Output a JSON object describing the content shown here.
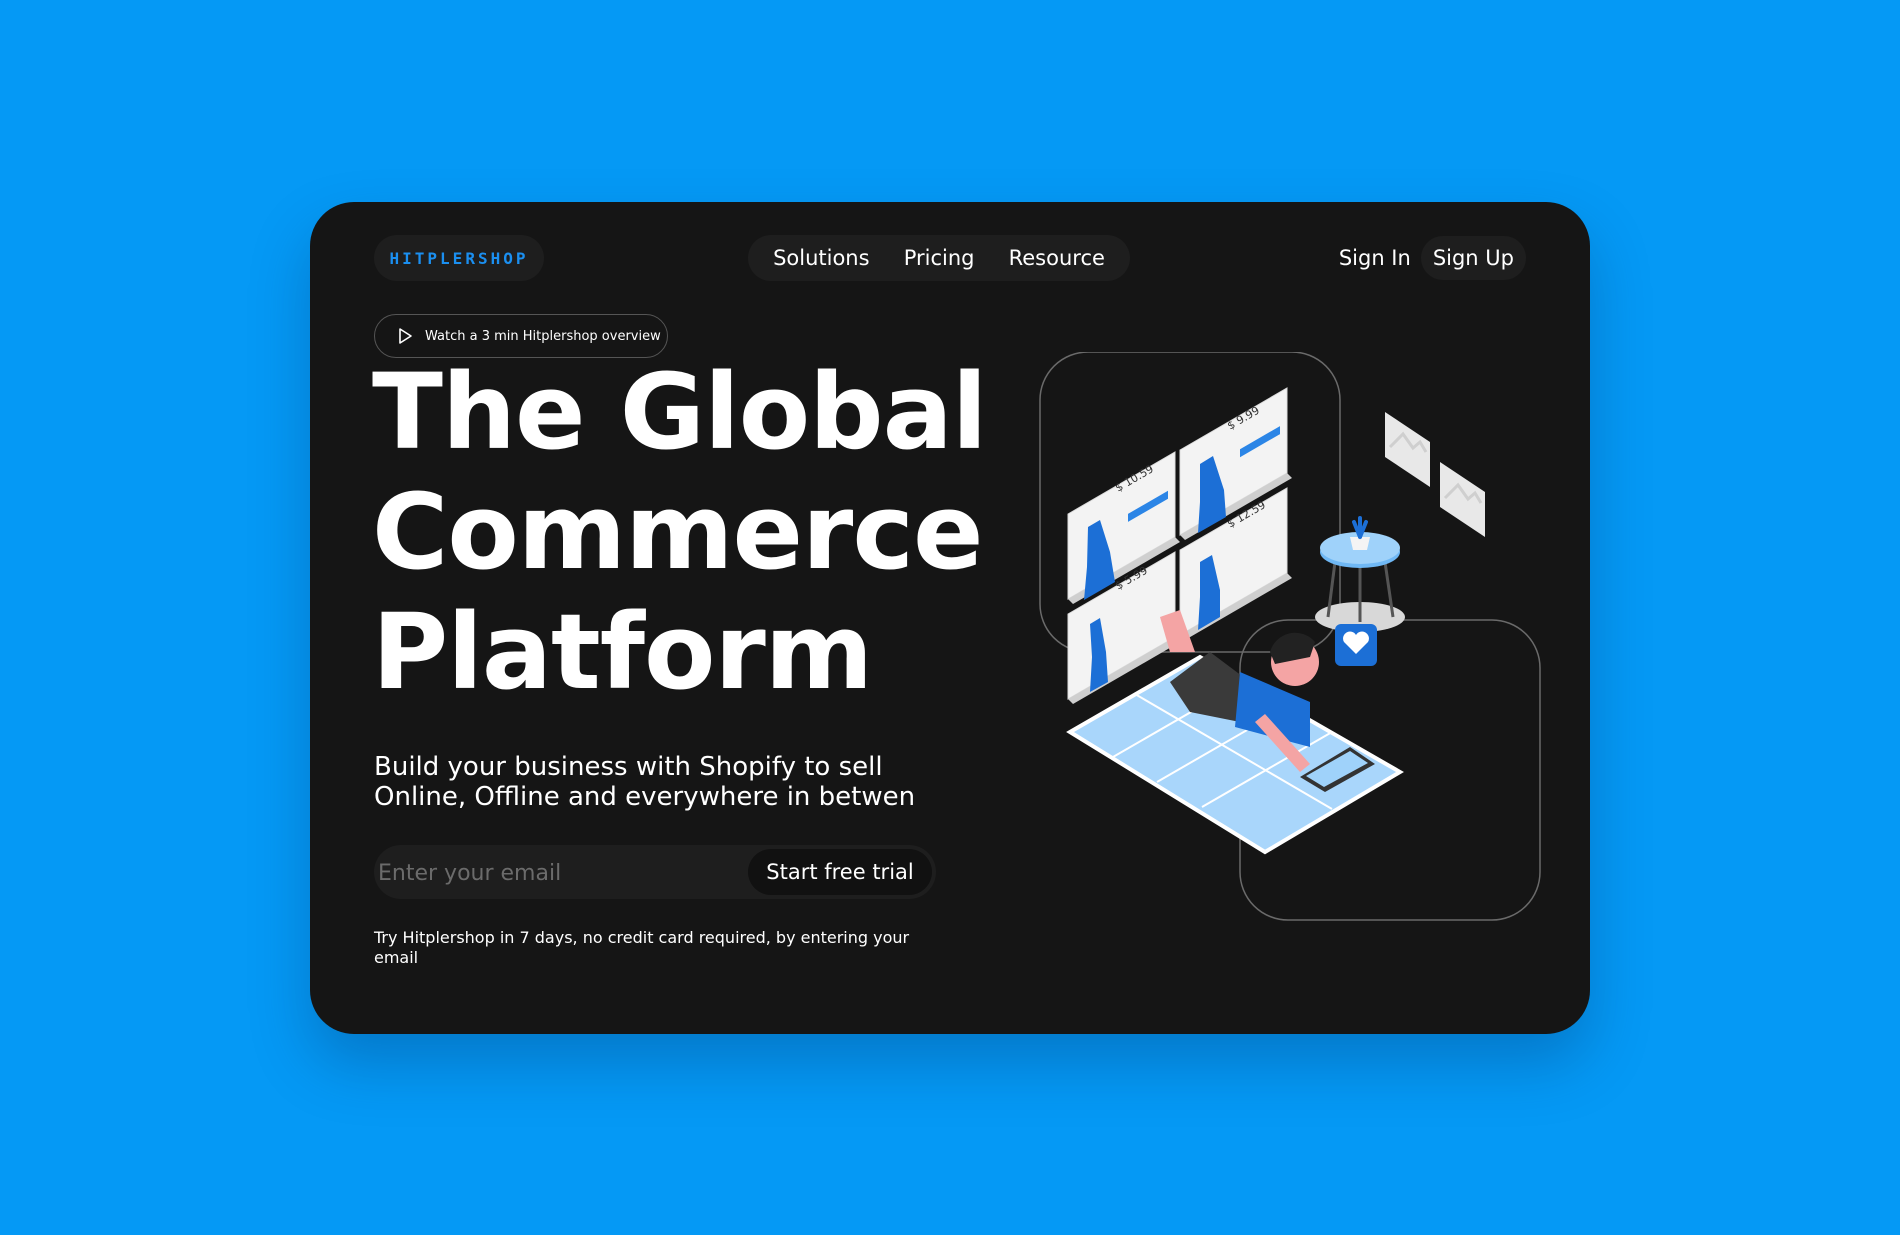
{
  "brand": {
    "logo": "HITPLERSHOP"
  },
  "nav": {
    "items": [
      "Solutions",
      "Pricing",
      "Resource"
    ]
  },
  "auth": {
    "sign_in": "Sign In",
    "sign_up": "Sign Up"
  },
  "hero": {
    "watch_label": "Watch a 3 min Hitplershop overview",
    "title_lines": [
      "The Global",
      "Commerce",
      "Platform"
    ],
    "subtitle": "Build your business with Shopify to sell Online, Offline and everywhere in betwen",
    "email_placeholder": "Enter your email",
    "cta": "Start free trial",
    "fine_print": "Try Hitplershop in 7 days, no credit card required, by entering your email"
  },
  "illustration": {
    "prices": [
      "$ 10.59",
      "$ 9.99",
      "$ 5.99",
      "$ 12.59"
    ]
  },
  "colors": {
    "background": "#0599f5",
    "card": "#151515",
    "accent": "#1b8ff0"
  }
}
